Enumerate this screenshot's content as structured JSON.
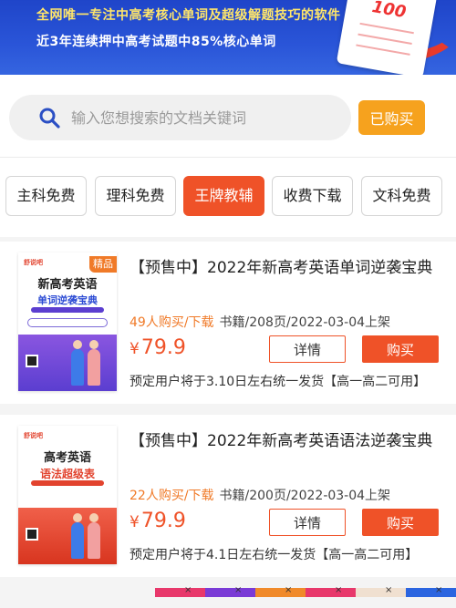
{
  "banner": {
    "line1": "全网唯一专注中高考核心单词及超级解题技巧的软件",
    "line2": "近3年连续押中高考试题中85%核心单词",
    "paper_score": "100"
  },
  "search": {
    "placeholder": "输入您想搜索的文档关键词",
    "bought_label": "已购买"
  },
  "tabs": [
    {
      "label": "主科免费"
    },
    {
      "label": "理科免费"
    },
    {
      "label": "王牌教辅",
      "active": true
    },
    {
      "label": "收费下载"
    },
    {
      "label": "文科免费"
    }
  ],
  "products": [
    {
      "badge": "精品",
      "cover_logo": "舒说吧",
      "cover_title1": "新高考英语",
      "cover_title2": "单词逆袭宝典",
      "title": "【预售中】2022年新高考英语单词逆袭宝典",
      "sold": "49人购买/下载",
      "info": "书籍/208页/2022-03-04上架",
      "currency": "¥",
      "price": "79.9",
      "detail_label": "详情",
      "buy_label": "购买",
      "note": "预定用户将于3.10日左右统一发货【高一高二可用】"
    },
    {
      "badge": "",
      "cover_logo": "舒说吧",
      "cover_title1": "高考英语",
      "cover_title2": "语法超级表",
      "title": "【预售中】2022年新高考英语语法逆袭宝典",
      "sold": "22人购买/下载",
      "info": "书籍/200页/2022-03-04上架",
      "currency": "¥",
      "price": "79.9",
      "detail_label": "详情",
      "buy_label": "购买",
      "note": "预定用户将于4.1日左右统一发货【高一高二可用】"
    }
  ],
  "ads": {
    "colors": [
      "#e8386b",
      "#7a3bd6",
      "#f08a2a",
      "#e8386b",
      "#f0e0d0",
      "#2b65e0"
    ],
    "close_glyph": "×"
  }
}
